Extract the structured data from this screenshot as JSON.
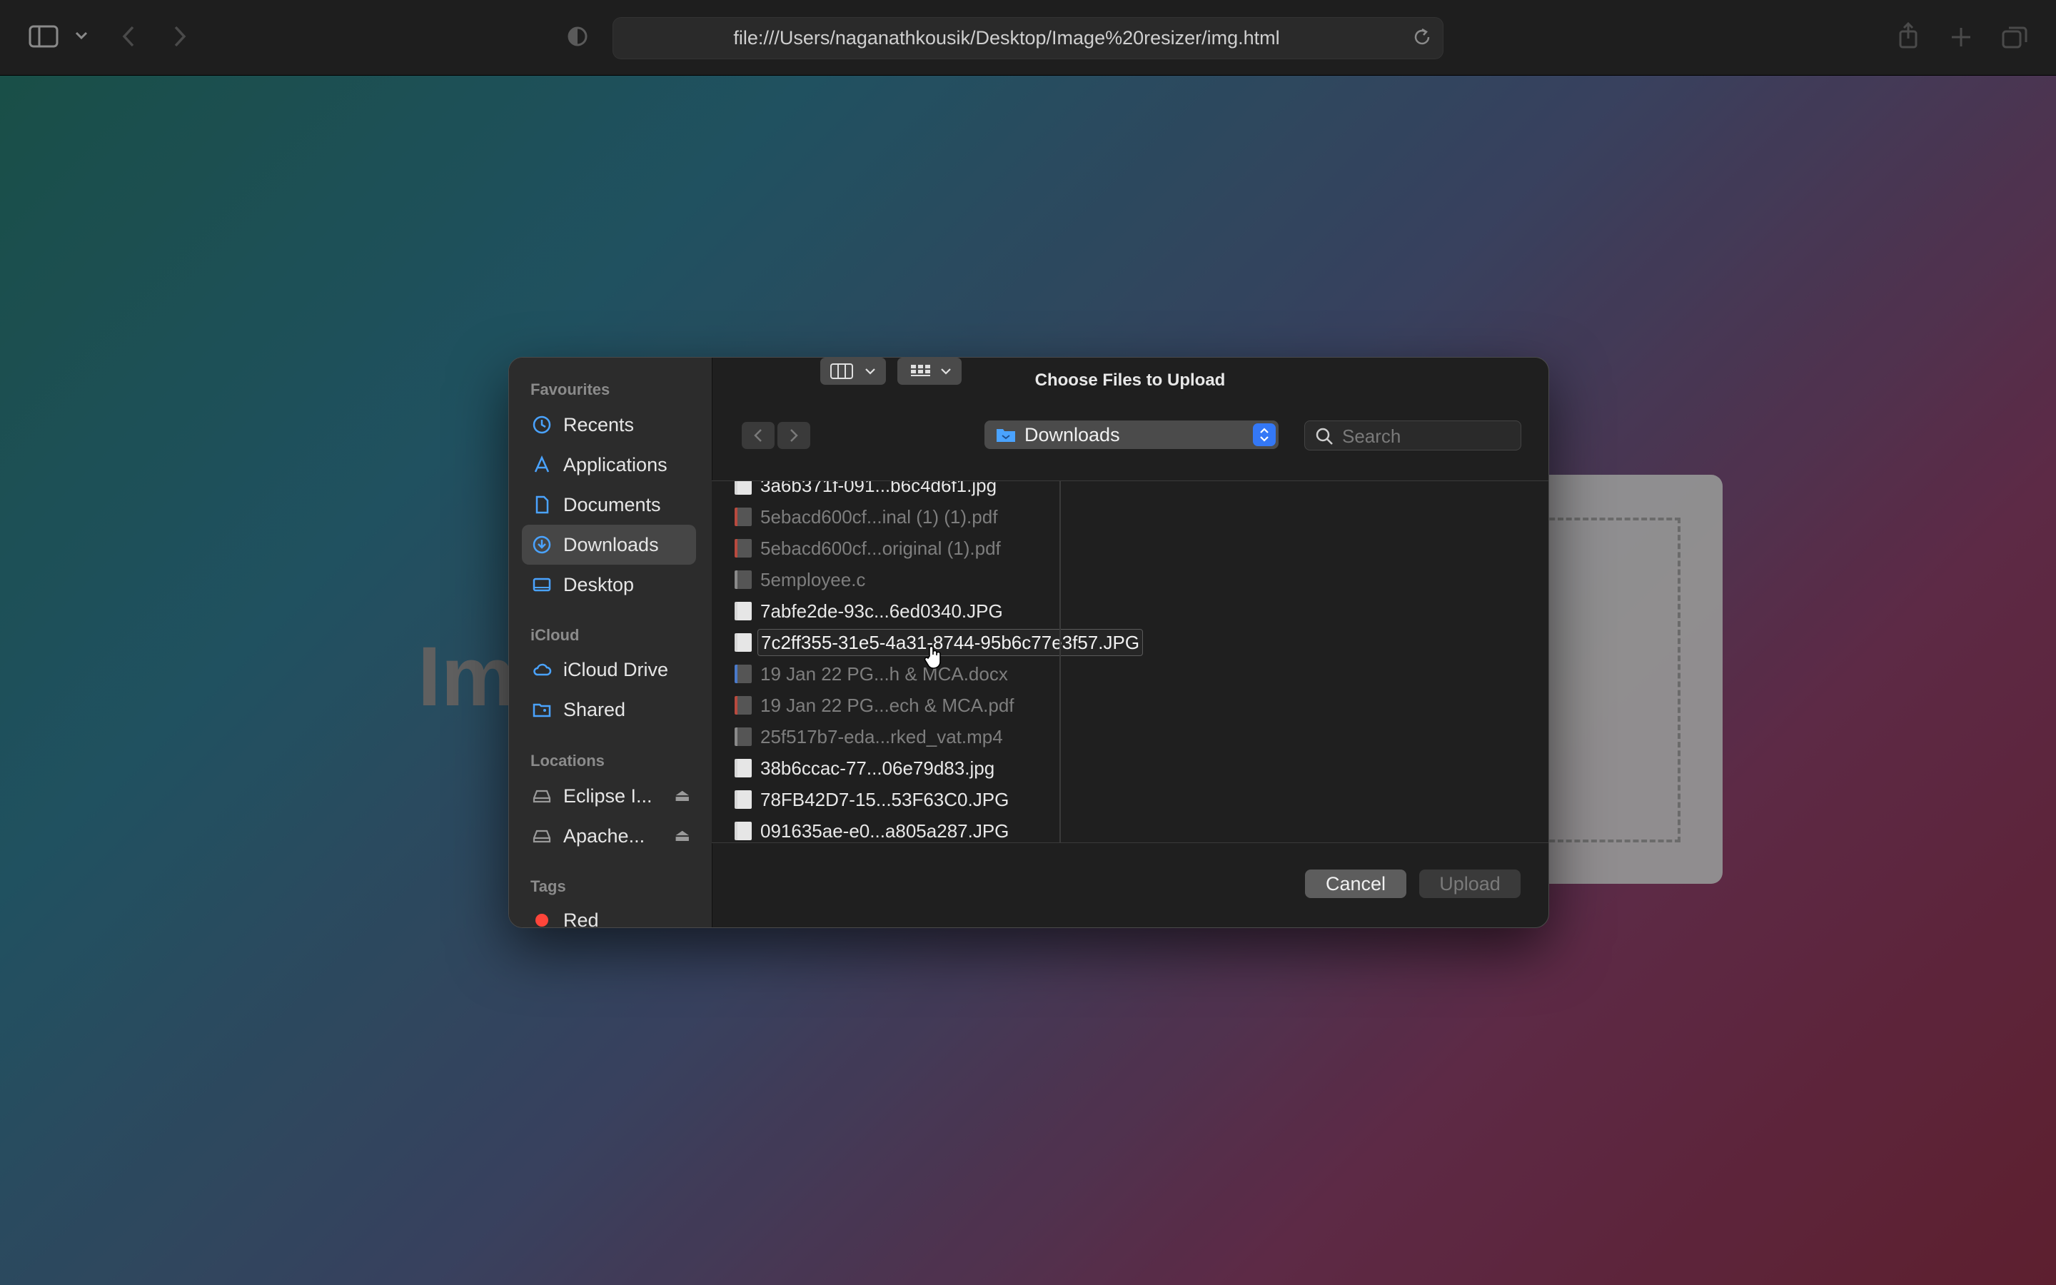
{
  "browser": {
    "url": "file:///Users/naganathkousik/Desktop/Image%20resizer/img.html"
  },
  "page": {
    "heading_fragment": "Im"
  },
  "dialog": {
    "title": "Choose Files to Upload",
    "location": "Downloads",
    "search_placeholder": "Search",
    "cancel_label": "Cancel",
    "upload_label": "Upload"
  },
  "sidebar": {
    "favourites_heading": "Favourites",
    "favourites": [
      {
        "label": "Recents",
        "icon": "clock-icon"
      },
      {
        "label": "Applications",
        "icon": "applications-icon"
      },
      {
        "label": "Documents",
        "icon": "document-icon"
      },
      {
        "label": "Downloads",
        "icon": "download-icon",
        "selected": true
      },
      {
        "label": "Desktop",
        "icon": "desktop-icon"
      }
    ],
    "icloud_heading": "iCloud",
    "icloud": [
      {
        "label": "iCloud Drive",
        "icon": "cloud-icon"
      },
      {
        "label": "Shared",
        "icon": "shared-folder-icon"
      }
    ],
    "locations_heading": "Locations",
    "locations": [
      {
        "label": "Eclipse I...",
        "icon": "drive-icon"
      },
      {
        "label": "Apache...",
        "icon": "drive-icon"
      }
    ],
    "tags_heading": "Tags",
    "tags": [
      {
        "label": "Red",
        "color": "#ff453a"
      }
    ]
  },
  "files": [
    {
      "name": "3a6b371f-091...b6c4d6f1.jpg",
      "state": "normal",
      "icon": "image-file-icon"
    },
    {
      "name": "5ebacd600cf...inal (1) (1).pdf",
      "state": "dim",
      "icon": "pdf-file-icon"
    },
    {
      "name": "5ebacd600cf...original (1).pdf",
      "state": "dim",
      "icon": "pdf-file-icon"
    },
    {
      "name": "5employee.c",
      "state": "dim",
      "icon": "c-file-icon"
    },
    {
      "name": "7abfe2de-93c...6ed0340.JPG",
      "state": "normal",
      "icon": "image-file-icon"
    },
    {
      "name": "7c2ff355-31e5-4a31-8744-95b6c77e3f57.JPG",
      "state": "sel",
      "icon": "image-file-icon"
    },
    {
      "name": "19 Jan 22 PG...h & MCA.docx",
      "state": "dim",
      "icon": "word-file-icon"
    },
    {
      "name": "19 Jan 22 PG...ech & MCA.pdf",
      "state": "dim",
      "icon": "pdf-file-icon"
    },
    {
      "name": "25f517b7-eda...rked_vat.mp4",
      "state": "dim",
      "icon": "video-file-icon"
    },
    {
      "name": "38b6ccac-77...06e79d83.jpg",
      "state": "normal",
      "icon": "image-file-icon"
    },
    {
      "name": "78FB42D7-15...53F63C0.JPG",
      "state": "normal",
      "icon": "image-file-icon"
    },
    {
      "name": "091635ae-e0...a805a287.JPG",
      "state": "normal",
      "icon": "image-file-icon"
    }
  ],
  "colors": {
    "accent": "#3478f6",
    "sidebar_icon": "#4aa3ff",
    "pdf_red": "#c0392b"
  }
}
